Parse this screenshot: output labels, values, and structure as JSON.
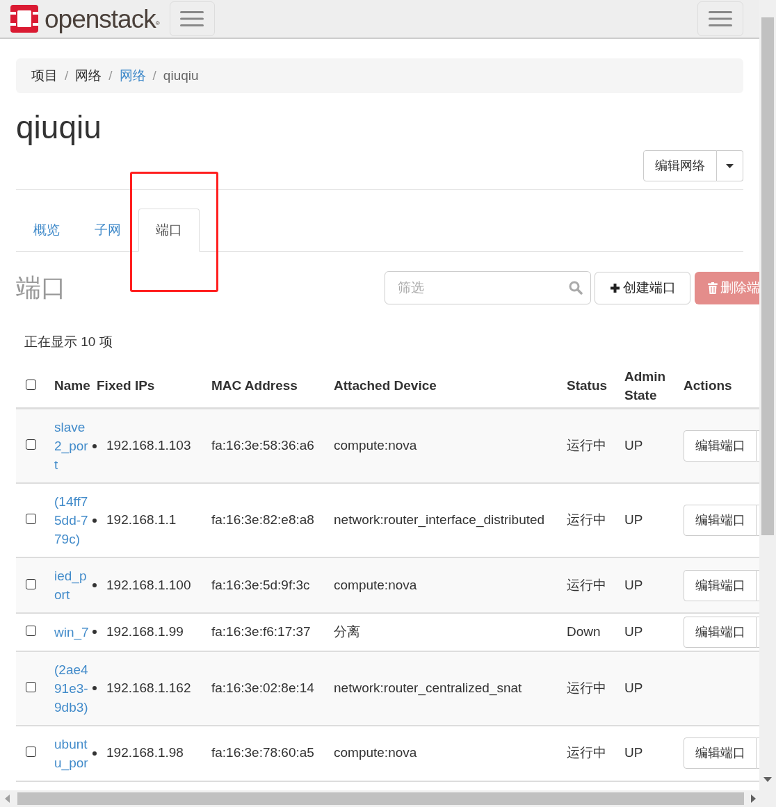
{
  "header": {
    "brand": "openstack",
    "brand_mark": "®"
  },
  "breadcrumb_separator": "/",
  "breadcrumb": [
    {
      "label": "项目",
      "link": false
    },
    {
      "label": "网络",
      "link": false
    },
    {
      "label": "网络",
      "link": true
    },
    {
      "label": "qiuqiu",
      "link": false
    }
  ],
  "title": "qiuqiu",
  "edit_network_button": "编辑网络",
  "tabs": [
    {
      "label": "概览",
      "selected": false
    },
    {
      "label": "子网",
      "selected": false
    },
    {
      "label": "端口",
      "selected": true
    }
  ],
  "section_title": "端口",
  "filter": {
    "placeholder": "筛选"
  },
  "create_button": "创建端口",
  "delete_button": "删除端",
  "count_text": "正在显示 10 项",
  "table": {
    "select_all_checked": false,
    "columns": [
      "Name",
      "Fixed IPs",
      "MAC Address",
      "Attached Device",
      "Status",
      "Admin State",
      "Actions"
    ],
    "rows": [
      {
        "checked": false,
        "name": "slave2_port",
        "fixed_ip": "192.168.1.103",
        "mac": "fa:16:3e:58:36:a6",
        "device": "compute:nova",
        "status": "运行中",
        "admin_state": "UP",
        "action": "编辑端口"
      },
      {
        "checked": false,
        "name": "(14ff75dd-779c)",
        "fixed_ip": "192.168.1.1",
        "mac": "fa:16:3e:82:e8:a8",
        "device": "network:router_interface_distributed",
        "status": "运行中",
        "admin_state": "UP",
        "action": "编辑端口"
      },
      {
        "checked": false,
        "name": "ied_port",
        "fixed_ip": "192.168.1.100",
        "mac": "fa:16:3e:5d:9f:3c",
        "device": "compute:nova",
        "status": "运行中",
        "admin_state": "UP",
        "action": "编辑端口"
      },
      {
        "checked": false,
        "name": "win_7",
        "fixed_ip": "192.168.1.99",
        "mac": "fa:16:3e:f6:17:37",
        "device": "分离",
        "status": "Down",
        "admin_state": "UP",
        "action": "编辑端口"
      },
      {
        "checked": false,
        "name": "(2ae491e3-9db3)",
        "fixed_ip": "192.168.1.162",
        "mac": "fa:16:3e:02:8e:14",
        "device": "network:router_centralized_snat",
        "status": "运行中",
        "admin_state": "UP"
      },
      {
        "checked": false,
        "name": "ubuntu_por",
        "fixed_ip": "192.168.1.98",
        "mac": "fa:16:3e:78:60:a5",
        "device": "compute:nova",
        "status": "运行中",
        "admin_state": "UP",
        "action": "编辑端口"
      }
    ]
  }
}
